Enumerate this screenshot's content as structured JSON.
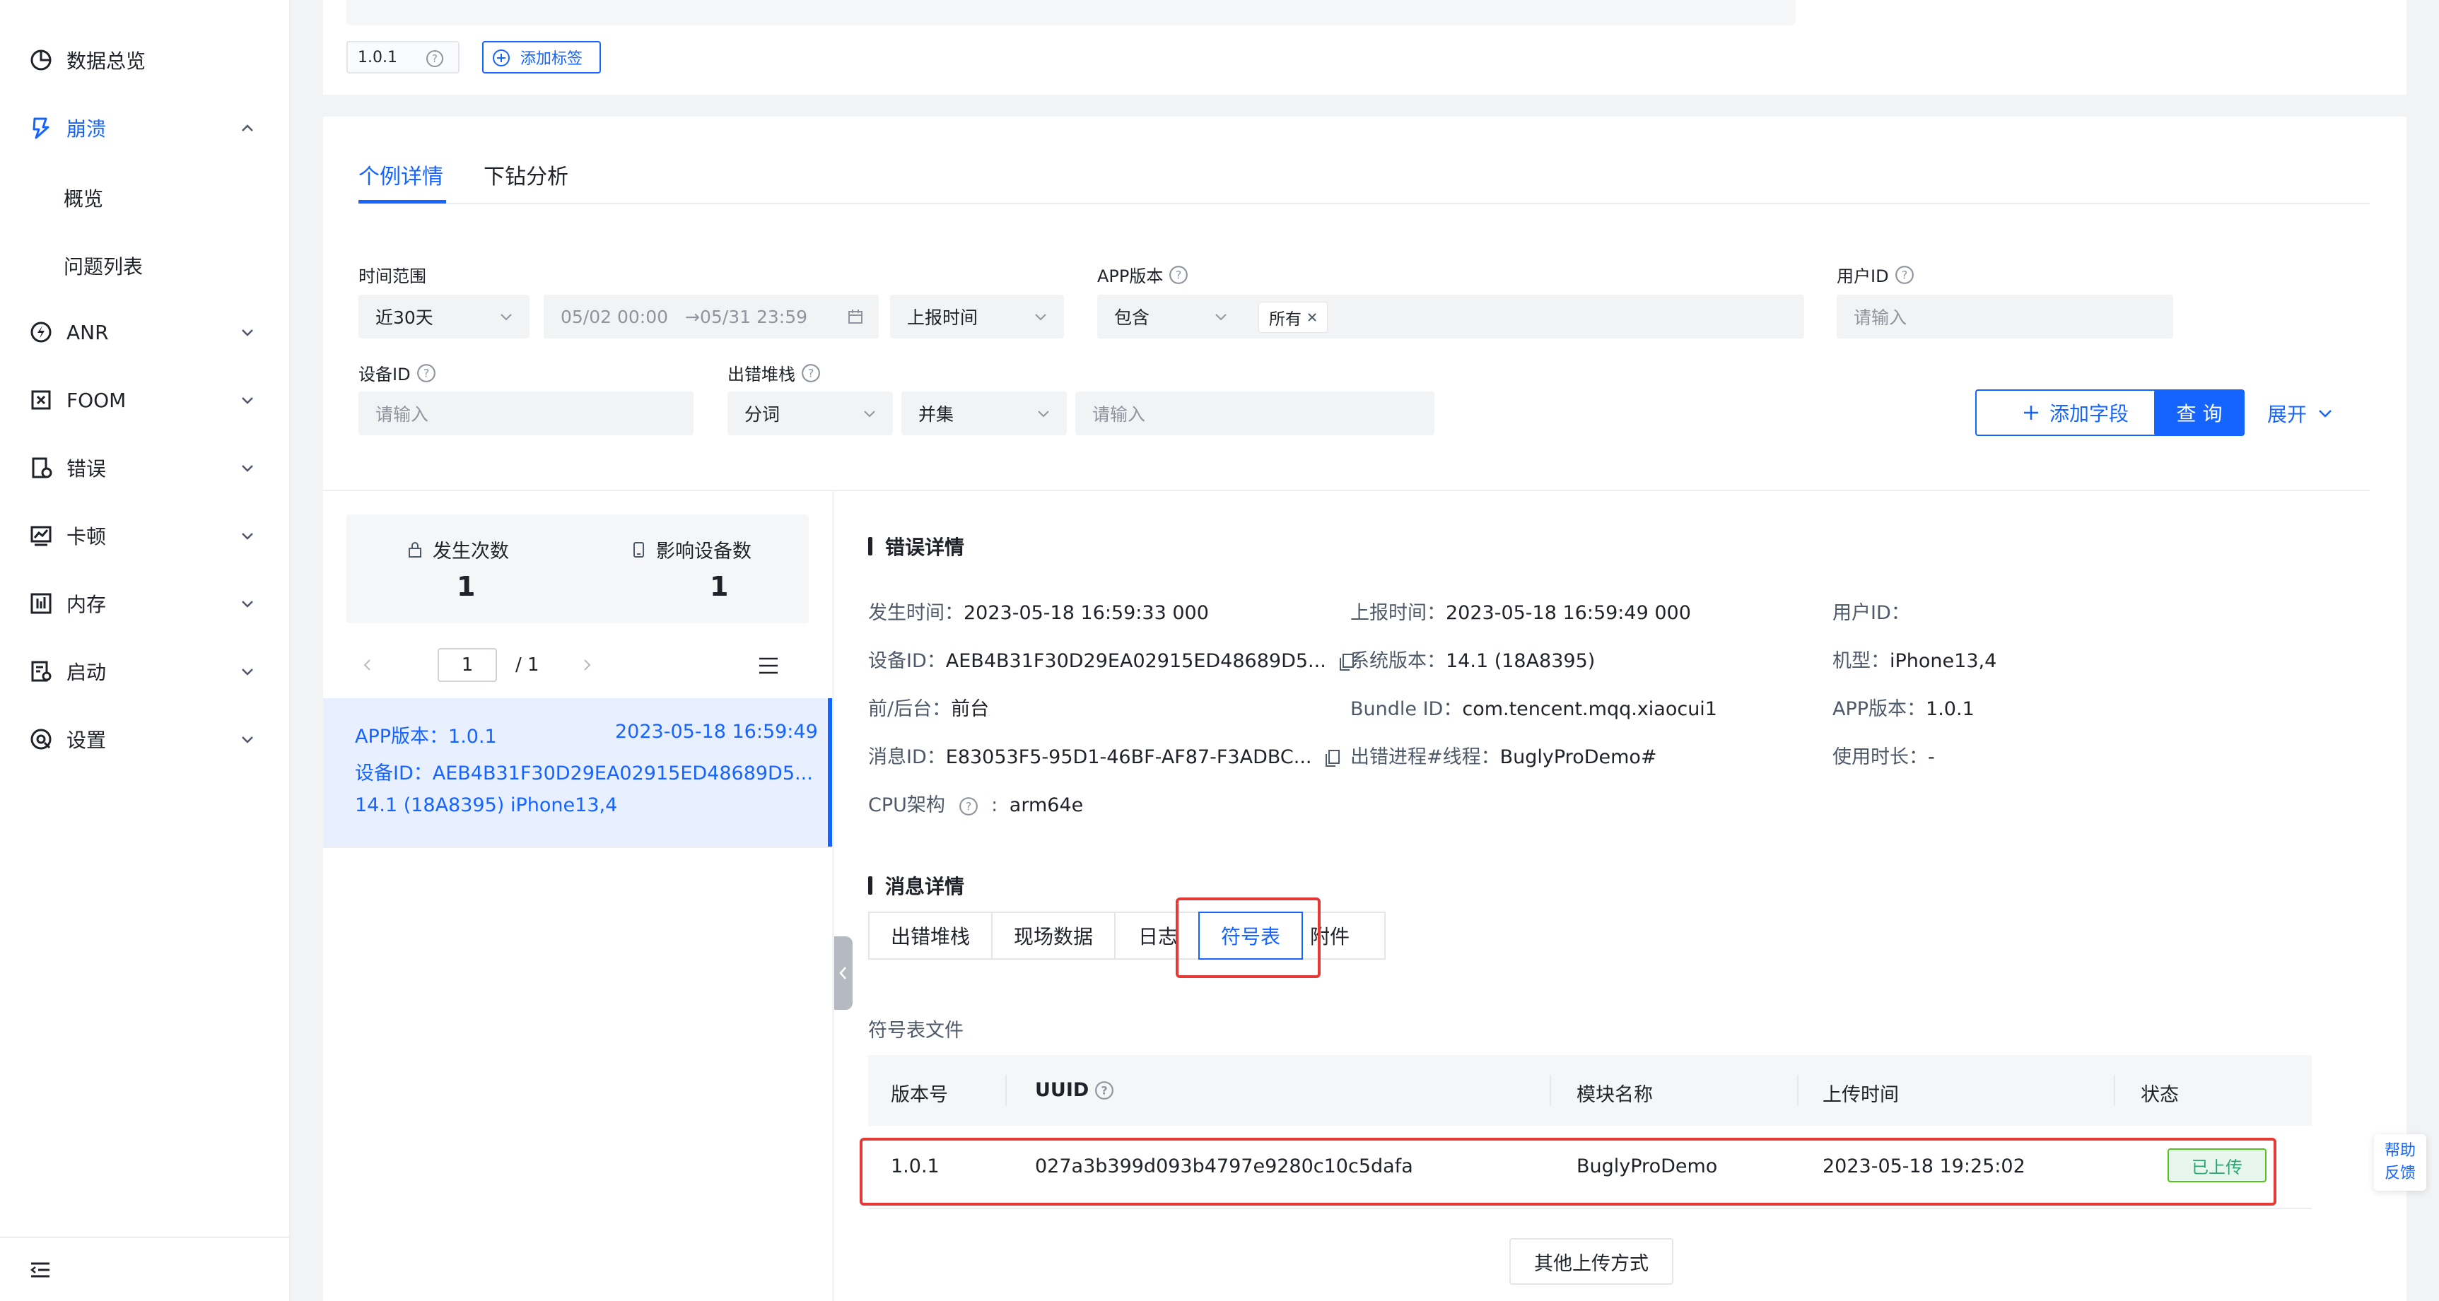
{
  "sidebar": {
    "items": [
      {
        "label": "数据总览",
        "icon": "pie-chart-icon"
      },
      {
        "label": "崩溃",
        "icon": "crash-icon",
        "active": true
      },
      {
        "label": "ANR",
        "icon": "anr-icon"
      },
      {
        "label": "FOOM",
        "icon": "foom-icon"
      },
      {
        "label": "错误",
        "icon": "error-icon"
      },
      {
        "label": "卡顿",
        "icon": "lag-icon"
      },
      {
        "label": "内存",
        "icon": "memory-icon"
      },
      {
        "label": "启动",
        "icon": "launch-icon"
      },
      {
        "label": "设置",
        "icon": "settings-icon"
      }
    ],
    "crash_sub": [
      "概览",
      "问题列表"
    ]
  },
  "top": {
    "version_tag": "1.0.1",
    "add_tag_label": "添加标签"
  },
  "tabs": [
    "个例详情",
    "下钻分析"
  ],
  "filters": {
    "time_range_label": "时间范围",
    "time_range_value": "近30天",
    "date_start": "05/02 00:00",
    "date_end": "→05/31 23:59",
    "time_type": "上报时间",
    "app_version_label": "APP版本",
    "app_version_op": "包含",
    "app_version_tag": "所有",
    "user_id_label": "用户ID",
    "user_id_placeholder": "请输入",
    "device_id_label": "设备ID",
    "device_id_placeholder": "请输入",
    "stack_label": "出错堆栈",
    "stack_mode": "分词",
    "stack_set": "并集",
    "stack_placeholder": "请输入",
    "add_field_label": "添加字段",
    "query_label": "查 询",
    "expand_label": "展开"
  },
  "stats": {
    "occur_label": "发生次数",
    "occur_value": "1",
    "device_label": "影响设备数",
    "device_value": "1"
  },
  "pager": {
    "current": "1",
    "total": "/ 1"
  },
  "case_item": {
    "app_version": "APP版本：1.0.1",
    "time": "2023-05-18 16:59:49",
    "device_id": "设备ID：AEB4B31F30D29EA02915ED48689D5...",
    "os": "14.1 (18A8395)",
    "model": "iPhone13,4"
  },
  "error_detail": {
    "title": "错误详情",
    "fields": [
      {
        "k": "发生时间：",
        "v": "2023-05-18 16:59:33 000"
      },
      {
        "k": "上报时间：",
        "v": "2023-05-18 16:59:49 000"
      },
      {
        "k": "用户ID：",
        "v": ""
      },
      {
        "k": "设备ID：",
        "v": "AEB4B31F30D29EA02915ED48689D5..."
      },
      {
        "k": "系统版本：",
        "v": "14.1 (18A8395)"
      },
      {
        "k": "机型：",
        "v": "iPhone13,4"
      },
      {
        "k": "前/后台：",
        "v": "前台"
      },
      {
        "k": "Bundle ID：",
        "v": "com.tencent.mqq.xiaocui1"
      },
      {
        "k": "APP版本：",
        "v": "1.0.1"
      },
      {
        "k": "消息ID：",
        "v": "E83053F5-95D1-46BF-AF87-F3ADBC..."
      },
      {
        "k": "出错进程#线程：",
        "v": "BuglyProDemo#"
      },
      {
        "k": "使用时长：",
        "v": "-"
      },
      {
        "k": "CPU架构",
        "v": "arm64e"
      }
    ]
  },
  "message_detail": {
    "title": "消息详情",
    "subtabs": [
      "出错堆栈",
      "现场数据",
      "日志",
      "符号表",
      "附件"
    ],
    "active_subtab": "符号表"
  },
  "symbol_table": {
    "caption": "符号表文件",
    "headers": [
      "版本号",
      "UUID",
      "模块名称",
      "上传时间",
      "状态"
    ],
    "rows": [
      {
        "version": "1.0.1",
        "uuid": "027a3b399d093b4797e9280c10c5dafa",
        "module": "BuglyProDemo",
        "upload_time": "2023-05-18 19:25:02",
        "status": "已上传"
      }
    ],
    "other_upload_label": "其他上传方式"
  },
  "help": {
    "line1": "帮助",
    "line2": "反馈"
  },
  "colors": {
    "accent": "#1664ff",
    "highlight": "#e53935",
    "success": "#2ba471"
  }
}
